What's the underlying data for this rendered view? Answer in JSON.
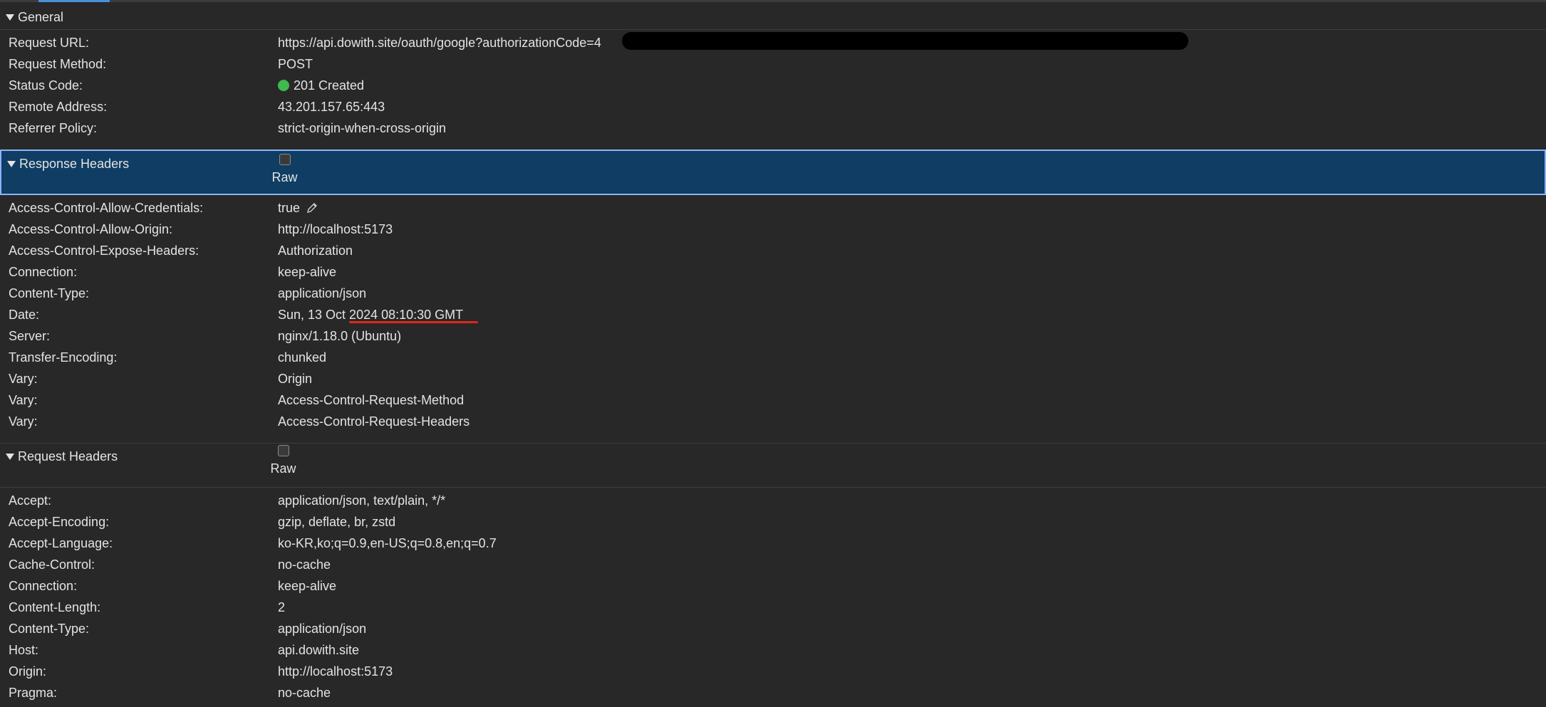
{
  "general": {
    "title": "General",
    "rows": [
      {
        "key": "Request URL:",
        "value": "https://api.dowith.site/oauth/google?authorizationCode=4"
      },
      {
        "key": "Request Method:",
        "value": "POST"
      },
      {
        "key": "Status Code:",
        "value": "201 Created"
      },
      {
        "key": "Remote Address:",
        "value": "43.201.157.65:443"
      },
      {
        "key": "Referrer Policy:",
        "value": "strict-origin-when-cross-origin"
      }
    ]
  },
  "response_headers": {
    "title": "Response Headers",
    "raw_label": "Raw",
    "rows": [
      {
        "key": "Access-Control-Allow-Credentials:",
        "value": "true"
      },
      {
        "key": "Access-Control-Allow-Origin:",
        "value": "http://localhost:5173"
      },
      {
        "key": "Access-Control-Expose-Headers:",
        "value": "Authorization"
      },
      {
        "key": "Connection:",
        "value": "keep-alive"
      },
      {
        "key": "Content-Type:",
        "value": "application/json"
      },
      {
        "key": "Date:",
        "value": "Sun, 13 Oct 2024 08:10:30 GMT"
      },
      {
        "key": "Server:",
        "value": "nginx/1.18.0 (Ubuntu)"
      },
      {
        "key": "Transfer-Encoding:",
        "value": "chunked"
      },
      {
        "key": "Vary:",
        "value": "Origin"
      },
      {
        "key": "Vary:",
        "value": "Access-Control-Request-Method"
      },
      {
        "key": "Vary:",
        "value": "Access-Control-Request-Headers"
      }
    ]
  },
  "request_headers": {
    "title": "Request Headers",
    "raw_label": "Raw",
    "rows": [
      {
        "key": "Accept:",
        "value": "application/json, text/plain, */*"
      },
      {
        "key": "Accept-Encoding:",
        "value": "gzip, deflate, br, zstd"
      },
      {
        "key": "Accept-Language:",
        "value": "ko-KR,ko;q=0.9,en-US;q=0.8,en;q=0.7"
      },
      {
        "key": "Cache-Control:",
        "value": "no-cache"
      },
      {
        "key": "Connection:",
        "value": "keep-alive"
      },
      {
        "key": "Content-Length:",
        "value": "2"
      },
      {
        "key": "Content-Type:",
        "value": "application/json"
      },
      {
        "key": "Host:",
        "value": "api.dowith.site"
      },
      {
        "key": "Origin:",
        "value": "http://localhost:5173"
      },
      {
        "key": "Pragma:",
        "value": "no-cache"
      }
    ]
  },
  "colors": {
    "background": "#282828",
    "selected_header": "#0f3d63",
    "status_ok": "#3fb950",
    "underline": "#e0261b"
  },
  "icons": {
    "disclosure": "triangle-down-icon",
    "edit": "pencil-icon",
    "status": "status-dot-icon"
  }
}
